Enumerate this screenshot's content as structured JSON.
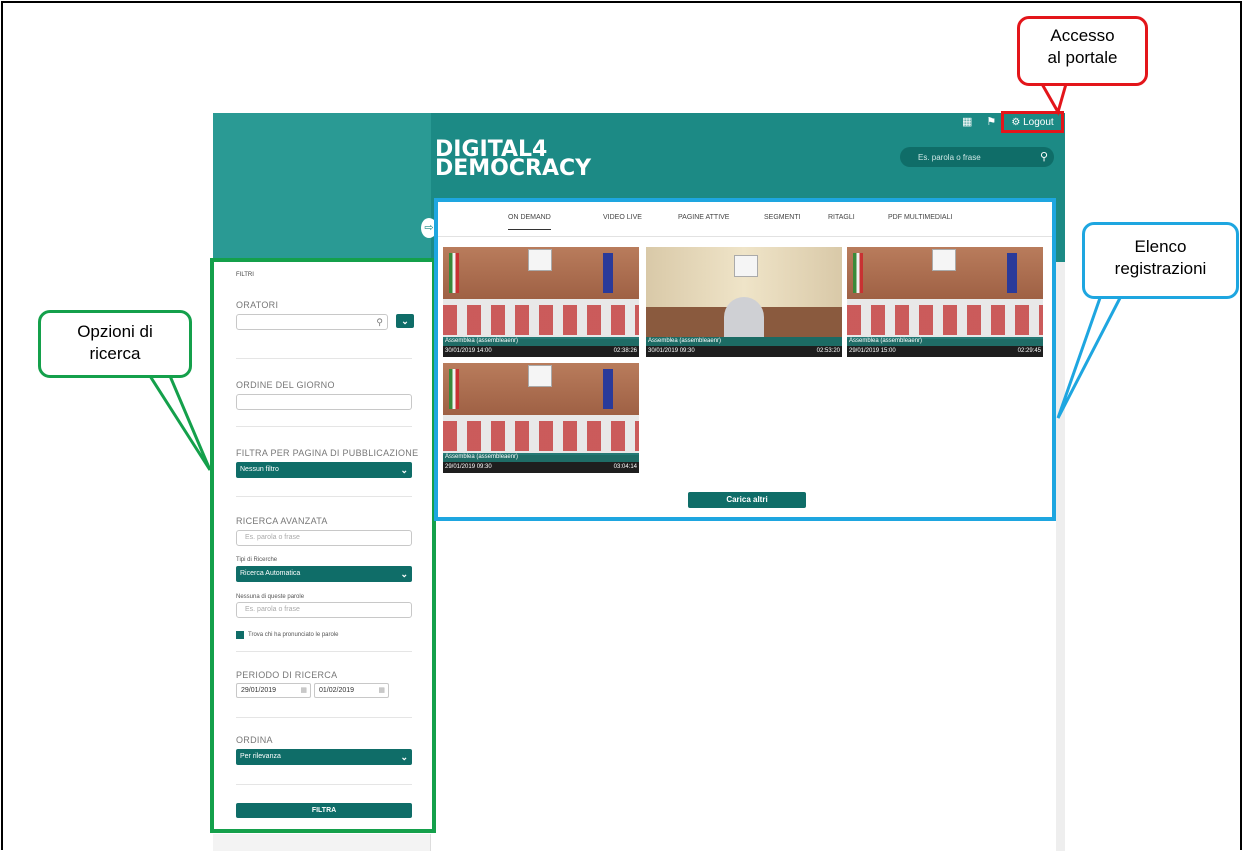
{
  "header": {
    "logo_line1": "DIGITAL4",
    "logo_line2": "DEMOCRACY",
    "logout_label": "Logout",
    "search_placeholder": "Es. parola o frase"
  },
  "filters": {
    "title": "FILTRI",
    "oratori_label": "ORATORI",
    "odg_label": "ORDINE DEL GIORNO",
    "filtra_pagina_label": "FILTRA PER PAGINA DI PUBBLICAZIONE",
    "filtra_pagina_value": "Nessun filtro",
    "ricerca_avanzata_label": "RICERCA AVANZATA",
    "ricerca_placeholder": "Es. parola o frase",
    "tipi_ricerche_label": "Tipi di Ricerche",
    "tipi_ricerche_value": "Ricerca Automatica",
    "nessuna_label": "Nessuna di queste parole",
    "nessuna_placeholder": "Es. parola o frase",
    "trova_label": "Trova chi ha pronunciato le parole",
    "periodo_label": "PERIODO DI RICERCA",
    "date_from": "29/01/2019",
    "date_to": "01/02/2019",
    "ordina_label": "ORDINA",
    "ordina_value": "Per rilevanza",
    "filtra_button": "FILTRA"
  },
  "tabs": [
    "ON DEMAND",
    "VIDEO LIVE",
    "PAGINE ATTIVE",
    "SEGMENTI",
    "RITAGLI",
    "PDF MULTIMEDIALI"
  ],
  "recordings": [
    {
      "title": "Assemblea (assembleaenr)",
      "date": "30/01/2019 14:00",
      "duration": "02:38:26"
    },
    {
      "title": "Assemblea (assembleaenr)",
      "date": "30/01/2019 09:30",
      "duration": "02:53:20"
    },
    {
      "title": "Assemblea (assembleaenr)",
      "date": "29/01/2019 15:00",
      "duration": "02:29:45"
    },
    {
      "title": "Assemblea (assembleaenr)",
      "date": "29/01/2019 09:30",
      "duration": "03:04:14"
    }
  ],
  "load_more": "Carica altri",
  "callouts": {
    "green_line1": "Opzioni di",
    "green_line2": "ricerca",
    "blue_line1": "Elenco",
    "blue_line2": "registrazioni",
    "red_line1": "Accesso",
    "red_line2": "al portale"
  },
  "colors": {
    "teal": "#1c8a85",
    "dark_teal": "#0f6d68",
    "green_border": "#14a04b",
    "blue_border": "#1ea6e0",
    "red_border": "#e3151a"
  }
}
